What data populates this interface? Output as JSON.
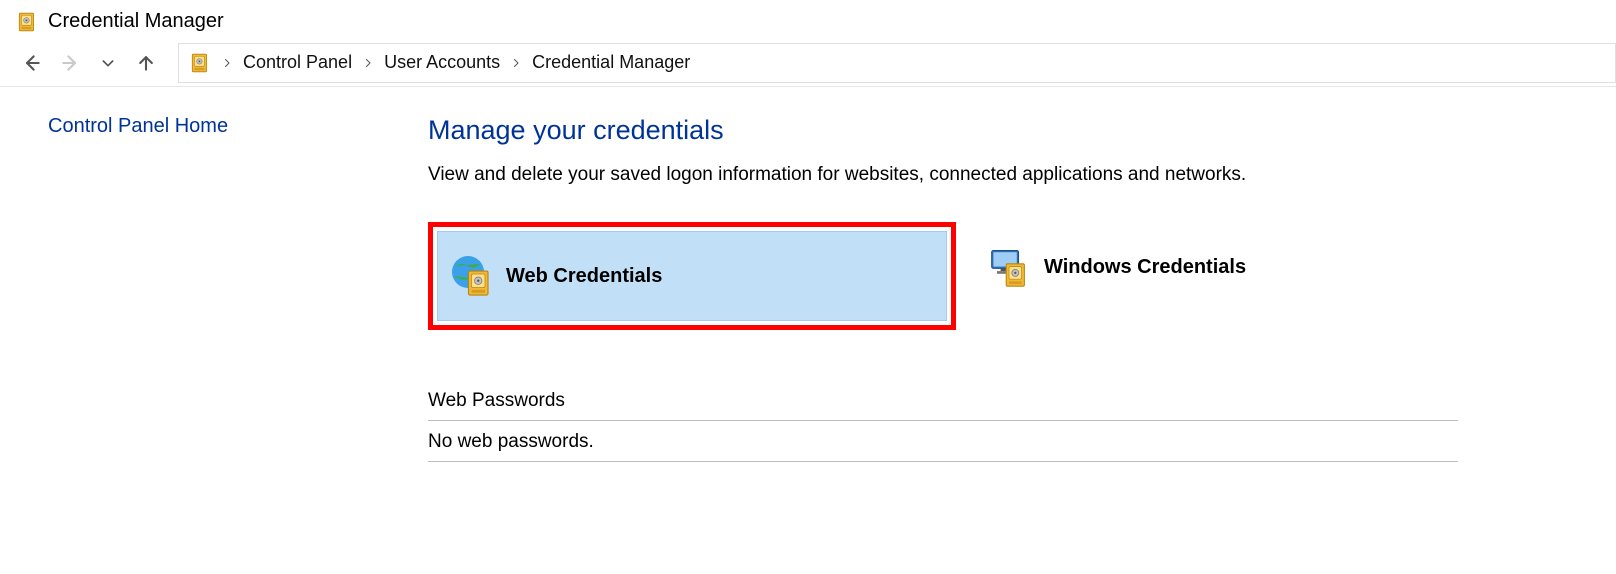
{
  "window": {
    "title": "Credential Manager"
  },
  "breadcrumb": {
    "items": [
      "Control Panel",
      "User Accounts",
      "Credential Manager"
    ]
  },
  "sidebar": {
    "home_link": "Control Panel Home"
  },
  "main": {
    "heading": "Manage your credentials",
    "description": "View and delete your saved logon information for websites, connected applications and networks.",
    "tiles": {
      "web": {
        "label": "Web Credentials",
        "selected": true
      },
      "windows": {
        "label": "Windows Credentials",
        "selected": false
      }
    },
    "section": {
      "title": "Web Passwords",
      "empty_text": "No web passwords."
    }
  }
}
